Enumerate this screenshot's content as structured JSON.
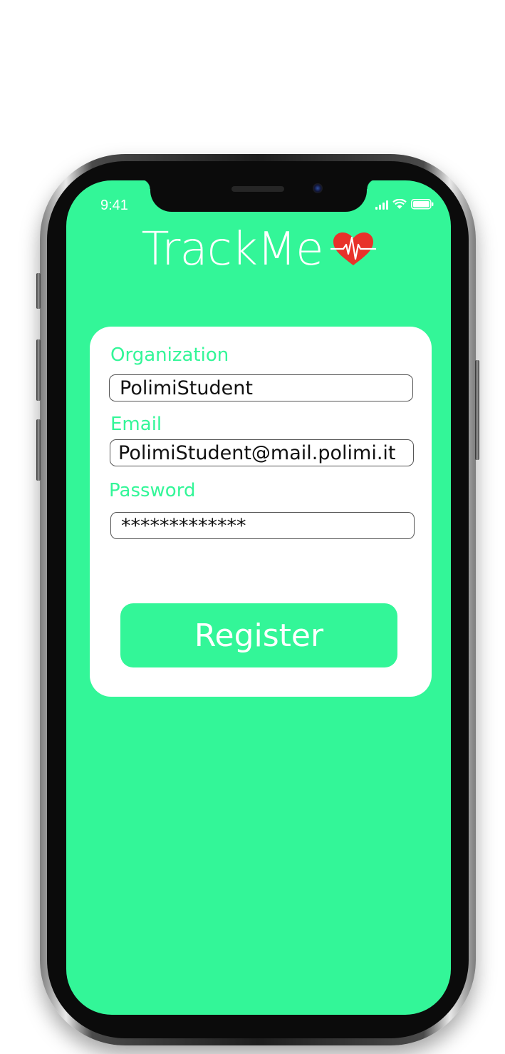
{
  "status_bar": {
    "time": "9:41",
    "icons": [
      "signal-icon",
      "wifi-icon",
      "battery-icon"
    ]
  },
  "app": {
    "title": "TrackMe",
    "logo_icon": "heart-pulse-icon",
    "accent_color": "#33f698",
    "heart_color": "#e8322a"
  },
  "form": {
    "organization": {
      "label": "Organization",
      "value": "PolimiStudent"
    },
    "email": {
      "label": "Email",
      "value": "PolimiStudent@mail.polimi.it"
    },
    "password": {
      "label": "Password",
      "value": "*************"
    },
    "register_label": "Register"
  }
}
